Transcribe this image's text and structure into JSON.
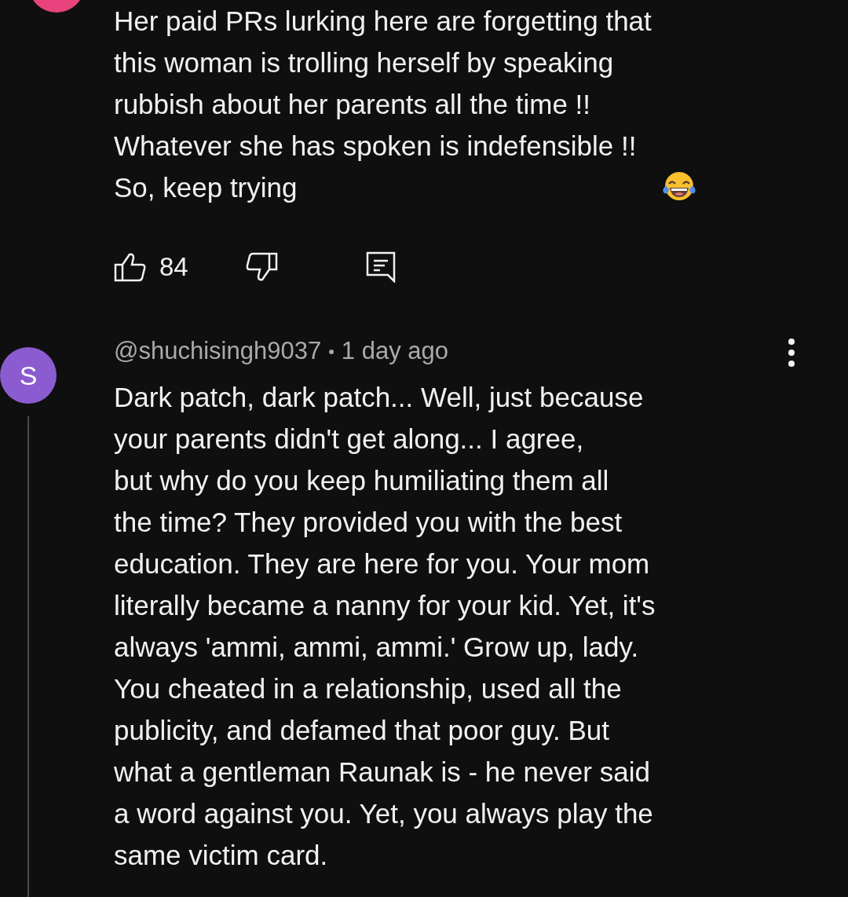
{
  "comments": [
    {
      "color": "#e8437c",
      "lines": [
        "Her paid PRs lurking here are forgetting that",
        "this woman is trolling herself by speaking",
        "rubbish about her parents all the time !!",
        "Whatever she has spoken is indefensible !!",
        "So, keep trying"
      ],
      "likes": "84"
    },
    {
      "color": "#8a5cd0",
      "avatar_letter": "S",
      "handle": "@shuchisingh9037",
      "separator": "•",
      "time": "1 day ago",
      "lines": [
        "Dark patch, dark patch... Well, just because",
        "your parents didn't get along... I agree,",
        "but why do you keep humiliating them all",
        "the time? They provided you with the best",
        "education. They are here for you. Your mom",
        "literally became a nanny for your kid. Yet, it's",
        "always 'ammi, ammi, ammi.' Grow up, lady.",
        "You cheated in a relationship, used all the",
        "publicity, and defamed that poor guy. But",
        "what a gentleman Raunak is - he never said",
        "a word against you. Yet, you always play the",
        "same victim card."
      ]
    }
  ]
}
